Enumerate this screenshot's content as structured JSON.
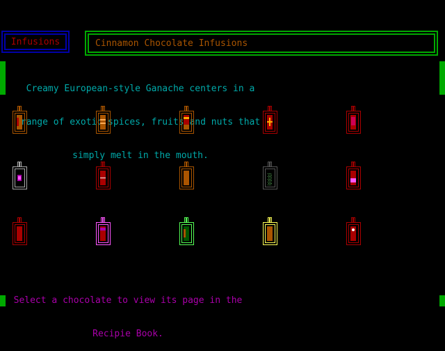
{
  "tab": {
    "label": "Infusions"
  },
  "title": {
    "label": "Cinnamon Chocolate Infusions"
  },
  "description": {
    "lines": [
      "Creamy European-style Ganache centers in a",
      "range of exotic spices, fruits and nuts that",
      "simply melt in the mouth."
    ]
  },
  "instruction": {
    "lines": [
      "Select a chocolate to view its page in the",
      "Recipie Book."
    ]
  },
  "colors": {
    "background": "#000000",
    "side_bars": "#00aa00",
    "tab_border": "#0000aa",
    "tab_text": "#aa0000",
    "title_border": "#00aa00",
    "title_text": "#aa5500",
    "description_text": "#00aaaa",
    "instruction_text": "#aa00aa"
  },
  "chocolates": [
    {
      "name": "chocolate-1",
      "outline": "#aa5500",
      "fill": "#aa5500",
      "mark": "#aa0000",
      "pattern": "stripes"
    },
    {
      "name": "chocolate-2",
      "outline": "#aa5500",
      "fill": "#aa5500",
      "mark": "#ffaa55",
      "pattern": "bars"
    },
    {
      "name": "chocolate-3",
      "outline": "#aa5500",
      "fill": "#aa0000",
      "mark": "#ffaa00",
      "pattern": "split"
    },
    {
      "name": "chocolate-4",
      "outline": "#aa0000",
      "fill": "#aa0000",
      "mark": "#ffaa00",
      "pattern": "cross"
    },
    {
      "name": "chocolate-5",
      "outline": "#aa0000",
      "fill": "#aa0000",
      "mark": "#cc0055",
      "pattern": "dots"
    },
    {
      "name": "chocolate-6",
      "outline": "#aaaaaa",
      "fill": "#aa00aa",
      "mark": "#ff55ff",
      "pattern": "solid-small"
    },
    {
      "name": "chocolate-7",
      "outline": "#aa0000",
      "fill": "#aa0000",
      "mark": "#ffffff",
      "pattern": "line"
    },
    {
      "name": "chocolate-8",
      "outline": "#aa5500",
      "fill": "#aa5500",
      "mark": "#aa5500",
      "pattern": "solid"
    },
    {
      "name": "chocolate-9",
      "outline": "#555555",
      "fill": "#000000",
      "mark": "#55aa55",
      "pattern": "speckle"
    },
    {
      "name": "chocolate-10",
      "outline": "#aa0000",
      "fill": "#aa0000",
      "mark": "#ff55ff",
      "pattern": "lower-block"
    },
    {
      "name": "chocolate-11",
      "outline": "#aa0000",
      "fill": "#aa0000",
      "mark": "#aa0000",
      "pattern": "solid"
    },
    {
      "name": "chocolate-12",
      "outline": "#ff55ff",
      "fill": "#aa0000",
      "mark": "#aa00aa",
      "pattern": "band"
    },
    {
      "name": "chocolate-13",
      "outline": "#55ff55",
      "fill": "#005500",
      "mark": "#aa5500",
      "pattern": "stripes"
    },
    {
      "name": "chocolate-14",
      "outline": "#ffff55",
      "fill": "#aa5500",
      "mark": "#aa5500",
      "pattern": "solid"
    },
    {
      "name": "chocolate-15",
      "outline": "#aa0000",
      "fill": "#aa0000",
      "mark": "#ffffff",
      "pattern": "dot"
    }
  ]
}
